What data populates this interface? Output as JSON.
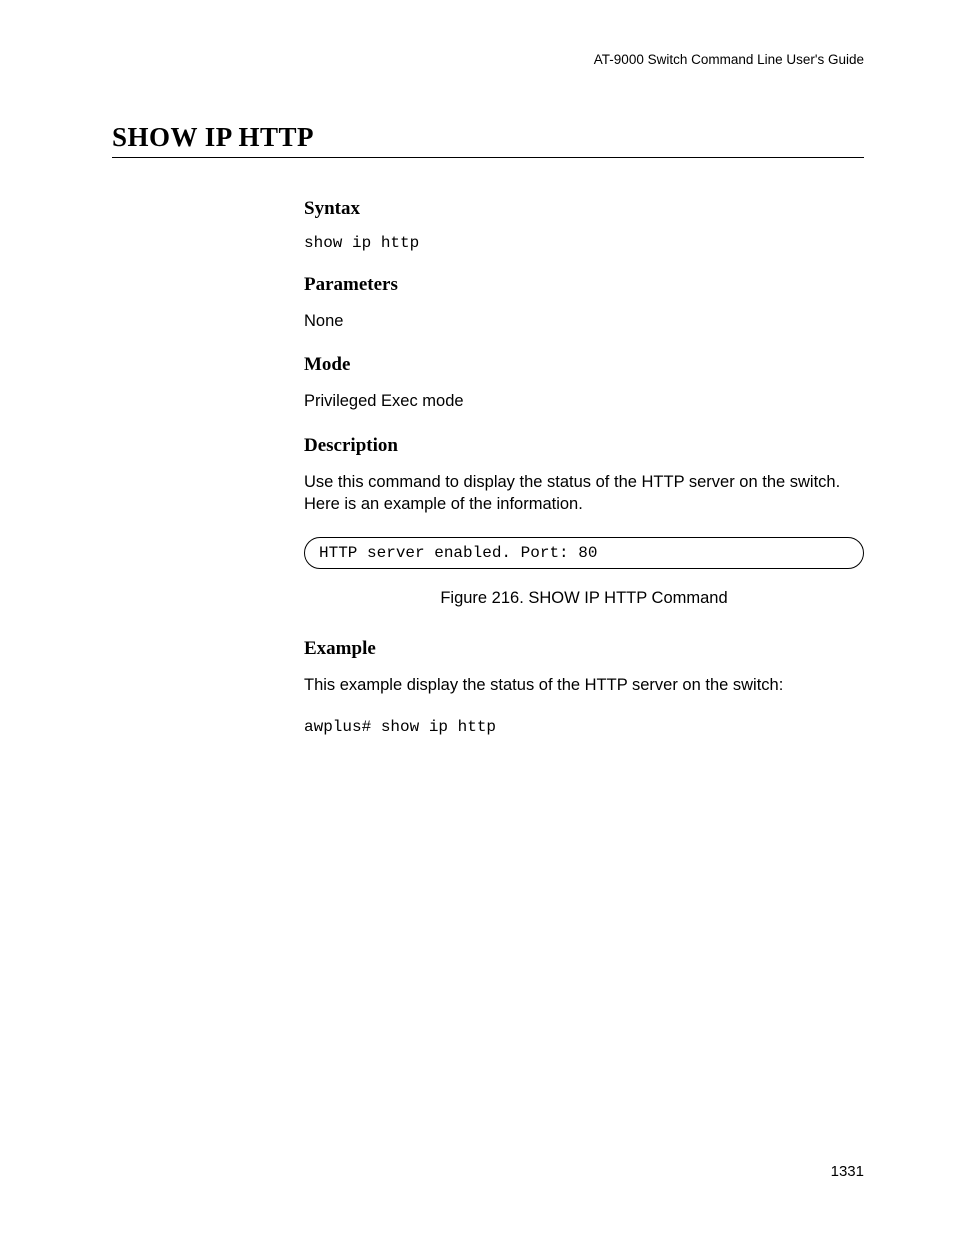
{
  "header": {
    "running": "AT-9000 Switch Command Line User's Guide"
  },
  "title": "SHOW IP HTTP",
  "sections": {
    "syntax": {
      "heading": "Syntax",
      "code": "show ip http"
    },
    "parameters": {
      "heading": "Parameters",
      "text": "None"
    },
    "mode": {
      "heading": "Mode",
      "text": "Privileged Exec mode"
    },
    "description": {
      "heading": "Description",
      "text": "Use this command to display the status of the HTTP server on the switch. Here is an example of the information.",
      "output": "HTTP server enabled. Port: 80",
      "figure_caption": "Figure 216. SHOW IP HTTP Command"
    },
    "example": {
      "heading": "Example",
      "text": "This example display the status of the HTTP server on the switch:",
      "code": "awplus# show ip http"
    }
  },
  "page_number": "1331"
}
